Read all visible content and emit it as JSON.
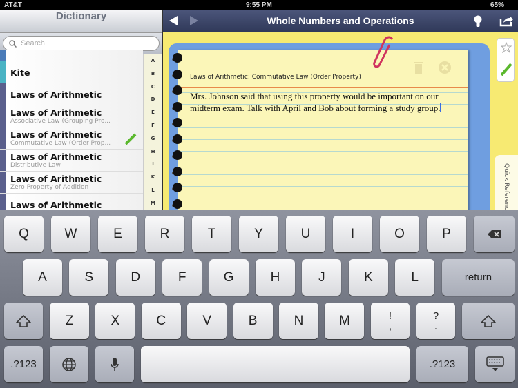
{
  "status": {
    "carrier": "AT&T",
    "time": "9:55 PM",
    "battery": "65%"
  },
  "sidebar": {
    "title": "Dictionary",
    "search_placeholder": "Search",
    "items": [
      {
        "title": "Kite",
        "subtitle": "",
        "color": "#4ab3c4"
      },
      {
        "title": "Laws of Arithmetic",
        "subtitle": "",
        "color": "#5a5f8c"
      },
      {
        "title": "Laws of Arithmetic",
        "subtitle": "Associative Law (Grouping Pro...",
        "color": "#5a5f8c"
      },
      {
        "title": "Laws of Arithmetic",
        "subtitle": "Commutative Law (Order Prop...",
        "color": "#5a5f8c"
      },
      {
        "title": "Laws of Arithmetic",
        "subtitle": "Distributive Law",
        "color": "#5a5f8c"
      },
      {
        "title": "Laws of Arithmetic",
        "subtitle": "Zero Property of Addition",
        "color": "#5a5f8c"
      },
      {
        "title": "Laws of Arithmetic",
        "subtitle": "",
        "color": "#5a5f8c"
      }
    ],
    "index": [
      "A",
      "B",
      "C",
      "D",
      "E",
      "F",
      "G",
      "H",
      "I",
      "K",
      "L",
      "M"
    ]
  },
  "main": {
    "title": "Whole Numbers and Operations",
    "note": {
      "title": "Laws of Arithmetic: Commutative Law (Order Property)",
      "body": "Mrs. Johnson said that using this property would be important on our midterm exam. Talk with April and Bob about forming a study group."
    },
    "tab_label": "Quick Reference"
  },
  "keyboard": {
    "row1": [
      "Q",
      "W",
      "E",
      "R",
      "T",
      "Y",
      "U",
      "I",
      "O",
      "P"
    ],
    "row2": [
      "A",
      "S",
      "D",
      "F",
      "G",
      "H",
      "J",
      "K",
      "L"
    ],
    "return": "return",
    "row3": [
      "Z",
      "X",
      "C",
      "V",
      "B",
      "N",
      "M"
    ],
    "excl": [
      "!",
      ","
    ],
    "quest": [
      "?",
      "."
    ],
    "numbers": ".?123"
  }
}
